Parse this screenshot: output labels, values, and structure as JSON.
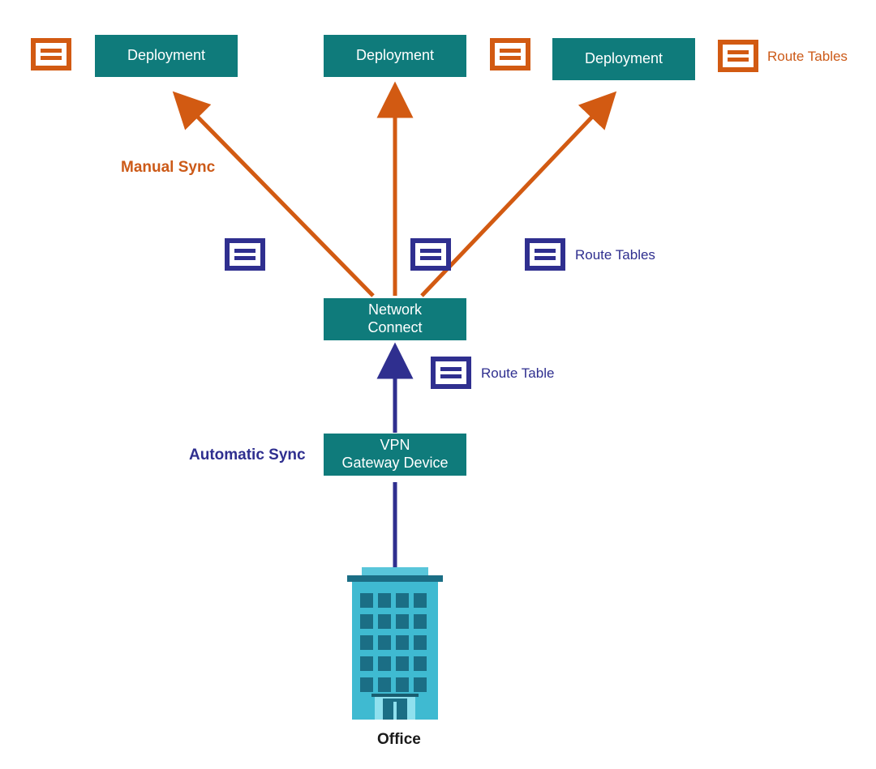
{
  "nodes": {
    "deployment1": "Deployment",
    "deployment2": "Deployment",
    "deployment3": "Deployment",
    "network_connect_l1": "Network",
    "network_connect_l2": "Connect",
    "vpn_l1": "VPN",
    "vpn_l2": "Gateway Device",
    "office": "Office"
  },
  "labels": {
    "manual_sync": "Manual Sync",
    "automatic_sync": "Automatic Sync",
    "route_tables_top": "Route Tables",
    "route_tables_mid": "Route Tables",
    "route_table_single": "Route Table"
  },
  "colors": {
    "teal": "#0f7b7b",
    "orange": "#d25a12",
    "blue": "#2f2f8f"
  },
  "diagram": {
    "description": "Office connects via VPN Gateway Device (Automatic Sync, blue arrow) to Network Connect. Network Connect fans out (Manual Sync, orange arrows) to three Deployment nodes. Orange route-table icons sit beside each Deployment; blue route-table icons sit beside Network Connect and the Office-to-VPN path."
  }
}
